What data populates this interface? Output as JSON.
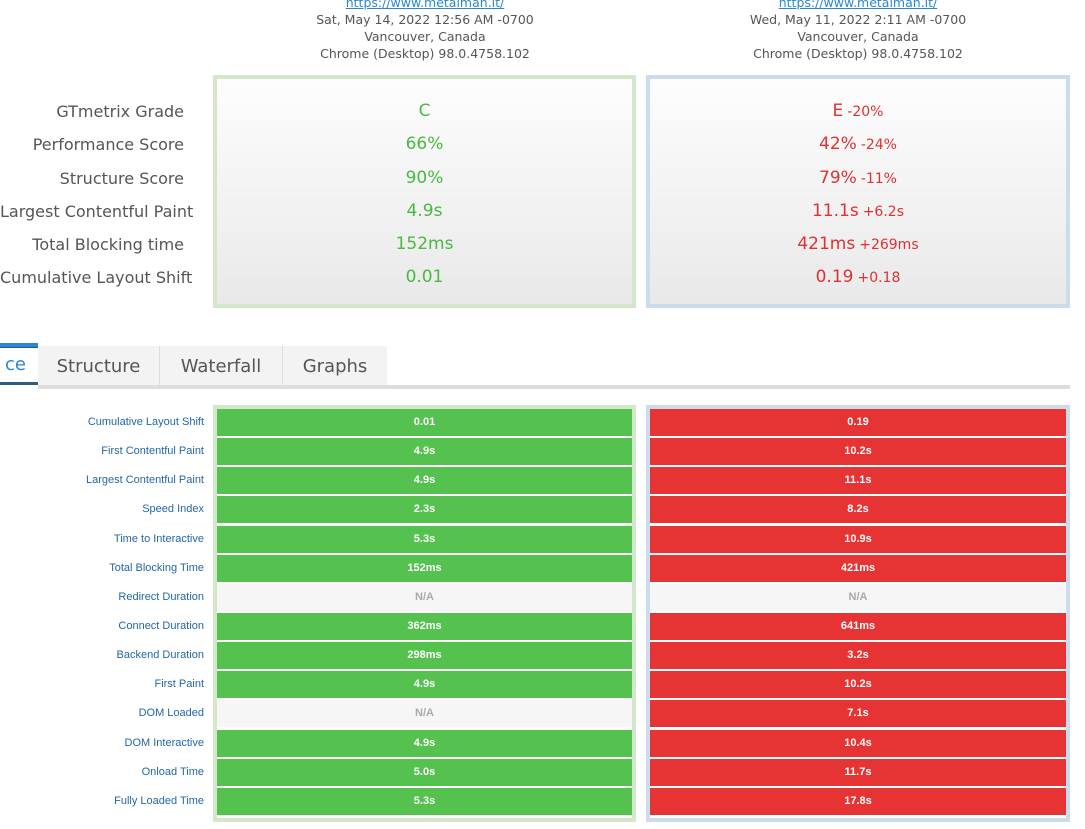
{
  "reports": [
    {
      "url": "https://www.metalman.it/",
      "date": "Sat, May 14, 2022 12:56 AM -0700",
      "location": "Vancouver, Canada",
      "browser": "Chrome (Desktop) 98.0.4758.102"
    },
    {
      "url": "https://www.metalman.it/",
      "date": "Wed, May 11, 2022 2:11 AM -0700",
      "location": "Vancouver, Canada",
      "browser": "Chrome (Desktop) 98.0.4758.102"
    }
  ],
  "summary": {
    "labels": [
      "GTmetrix Grade",
      "Performance Score",
      "Structure Score",
      "Largest Contentful Paint",
      "Total Blocking time",
      "Cumulative Layout Shift"
    ],
    "left": [
      {
        "value": "C",
        "delta": ""
      },
      {
        "value": "66%",
        "delta": ""
      },
      {
        "value": "90%",
        "delta": ""
      },
      {
        "value": "4.9s",
        "delta": ""
      },
      {
        "value": "152ms",
        "delta": ""
      },
      {
        "value": "0.01",
        "delta": ""
      }
    ],
    "right": [
      {
        "value": "E",
        "delta": "-20%"
      },
      {
        "value": "42%",
        "delta": "-24%"
      },
      {
        "value": "79%",
        "delta": "-11%"
      },
      {
        "value": "11.1s",
        "delta": "+6.2s"
      },
      {
        "value": "421ms",
        "delta": "+269ms"
      },
      {
        "value": "0.19",
        "delta": "+0.18"
      }
    ]
  },
  "tabs": [
    {
      "label": "ce",
      "active": true
    },
    {
      "label": "Structure",
      "active": false
    },
    {
      "label": "Waterfall",
      "active": false
    },
    {
      "label": "Graphs",
      "active": false
    }
  ],
  "metrics": {
    "labels": [
      "Cumulative Layout Shift",
      "First Contentful Paint",
      "Largest Contentful Paint",
      "Speed Index",
      "Time to Interactive",
      "Total Blocking Time",
      "Redirect Duration",
      "Connect Duration",
      "Backend Duration",
      "First Paint",
      "DOM Loaded",
      "DOM Interactive",
      "Onload Time",
      "Fully Loaded Time"
    ],
    "left": [
      {
        "value": "0.01",
        "status": "good"
      },
      {
        "value": "4.9s",
        "status": "good"
      },
      {
        "value": "4.9s",
        "status": "good"
      },
      {
        "value": "2.3s",
        "status": "good"
      },
      {
        "value": "5.3s",
        "status": "good"
      },
      {
        "value": "152ms",
        "status": "good"
      },
      {
        "value": "N/A",
        "status": "na"
      },
      {
        "value": "362ms",
        "status": "good"
      },
      {
        "value": "298ms",
        "status": "good"
      },
      {
        "value": "4.9s",
        "status": "good"
      },
      {
        "value": "N/A",
        "status": "na"
      },
      {
        "value": "4.9s",
        "status": "good"
      },
      {
        "value": "5.0s",
        "status": "good"
      },
      {
        "value": "5.3s",
        "status": "good"
      }
    ],
    "right": [
      {
        "value": "0.19",
        "status": "bad"
      },
      {
        "value": "10.2s",
        "status": "bad"
      },
      {
        "value": "11.1s",
        "status": "bad"
      },
      {
        "value": "8.2s",
        "status": "bad"
      },
      {
        "value": "10.9s",
        "status": "bad"
      },
      {
        "value": "421ms",
        "status": "bad"
      },
      {
        "value": "N/A",
        "status": "na"
      },
      {
        "value": "641ms",
        "status": "bad"
      },
      {
        "value": "3.2s",
        "status": "bad"
      },
      {
        "value": "10.2s",
        "status": "bad"
      },
      {
        "value": "7.1s",
        "status": "bad"
      },
      {
        "value": "10.4s",
        "status": "bad"
      },
      {
        "value": "11.7s",
        "status": "bad"
      },
      {
        "value": "17.8s",
        "status": "bad"
      }
    ]
  },
  "colors": {
    "good": "#55c14f",
    "bad": "#e63334",
    "good_text": "#48b941",
    "bad_text": "#e03131",
    "accent": "#2b87d1"
  }
}
